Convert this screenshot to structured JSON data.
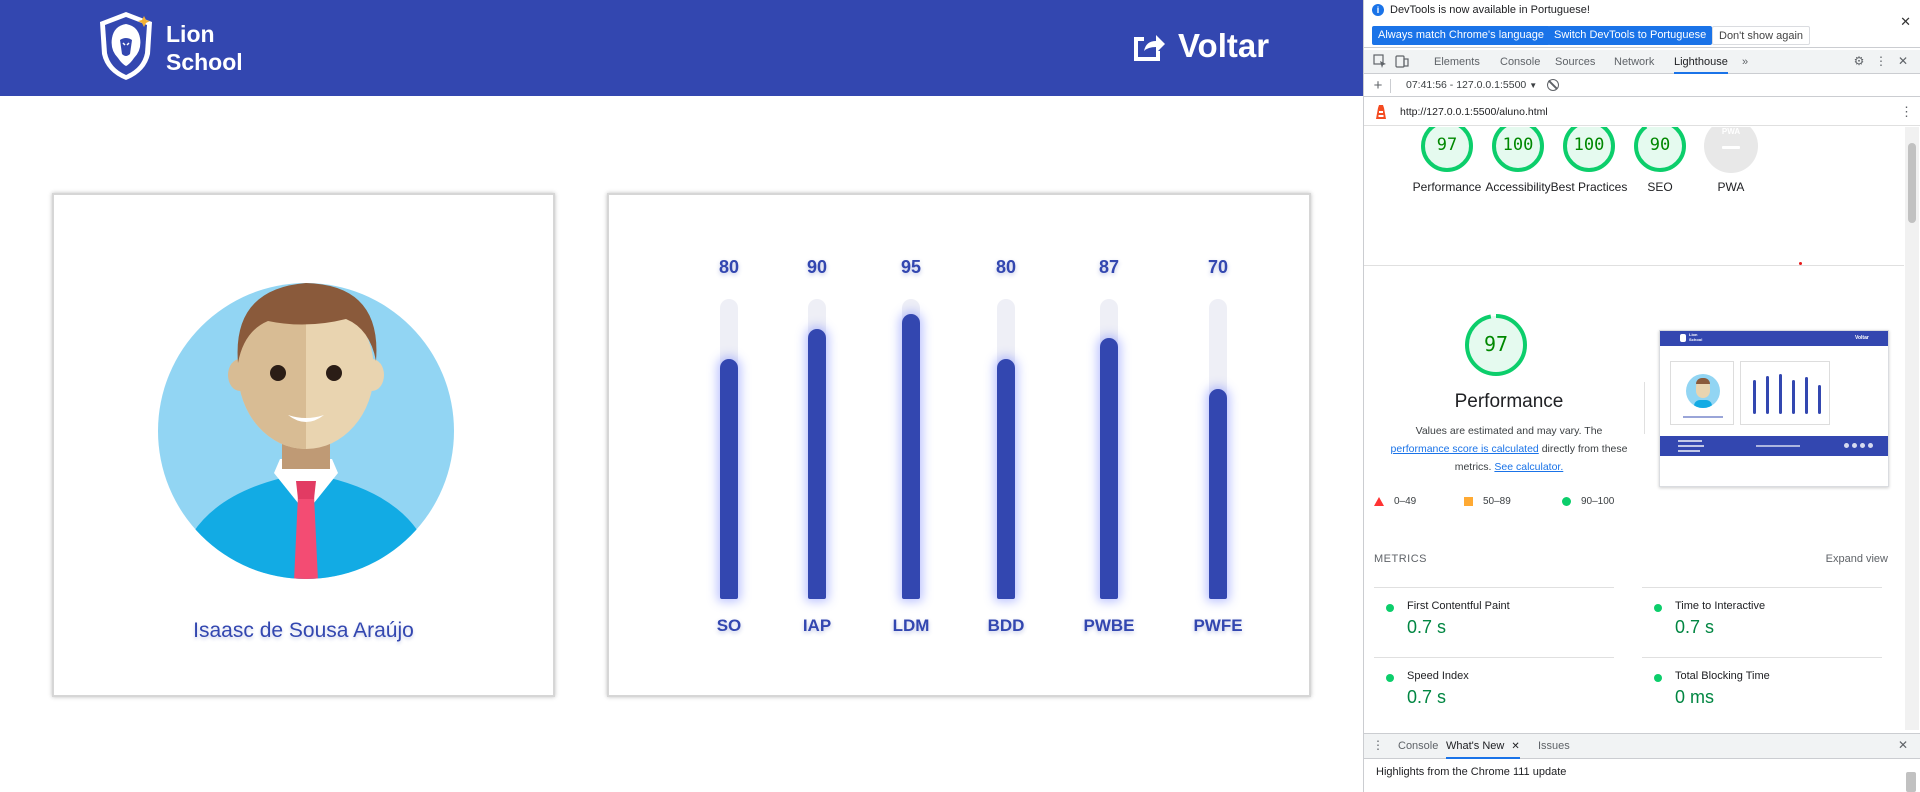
{
  "app": {
    "brand_line1": "Lion",
    "brand_line2": "School",
    "back_label": "Voltar",
    "student_name": "Isaasc de Sousa Araújo",
    "grades": [
      {
        "subject": "SO",
        "value": 80
      },
      {
        "subject": "IAP",
        "value": 90
      },
      {
        "subject": "LDM",
        "value": 95
      },
      {
        "subject": "BDD",
        "value": 80
      },
      {
        "subject": "PWBE",
        "value": 87
      },
      {
        "subject": "PWFE",
        "value": 70
      }
    ],
    "colors": {
      "primary": "#3347b0"
    }
  },
  "devtools": {
    "infobar": {
      "message": "DevTools is now available in Portuguese!",
      "btn_match": "Always match Chrome's language",
      "btn_switch": "Switch DevTools to Portuguese",
      "btn_dismiss": "Don't show again"
    },
    "tabs": [
      "Elements",
      "Console",
      "Sources",
      "Network",
      "Lighthouse"
    ],
    "active_tab": "Lighthouse",
    "report_selector": "07:41:56 - 127.0.0.1:5500",
    "url": "http://127.0.0.1:5500/aluno.html",
    "scores": [
      {
        "label": "Performance",
        "value": "97",
        "score": 97
      },
      {
        "label": "Accessibility",
        "value": "100",
        "score": 100
      },
      {
        "label": "Best Practices",
        "value": "100",
        "score": 100
      },
      {
        "label": "SEO",
        "value": "90",
        "score": 90
      },
      {
        "label": "PWA",
        "value": "PWA",
        "score": 0
      }
    ],
    "performance": {
      "score": "97",
      "title": "Performance",
      "desc_1": "Values are estimated and may vary. The",
      "desc_link1": "performance score is calculated",
      "desc_2": "directly from these metrics.",
      "desc_link2": "See calculator."
    },
    "legend": [
      "0–49",
      "50–89",
      "90–100"
    ],
    "metrics_heading": "METRICS",
    "expand_view": "Expand view",
    "metrics": [
      {
        "name": "First Contentful Paint",
        "value": "0.7 s"
      },
      {
        "name": "Time to Interactive",
        "value": "0.7 s"
      },
      {
        "name": "Speed Index",
        "value": "0.7 s"
      },
      {
        "name": "Total Blocking Time",
        "value": "0 ms"
      }
    ],
    "drawer_tabs": [
      "Console",
      "What's New",
      "Issues"
    ],
    "drawer_message": "Highlights from the Chrome 111 update",
    "thumb": {
      "back_label": "Voltar"
    },
    "colors": {
      "pass": "#0cce6b",
      "accent": "#1a73e8"
    }
  }
}
